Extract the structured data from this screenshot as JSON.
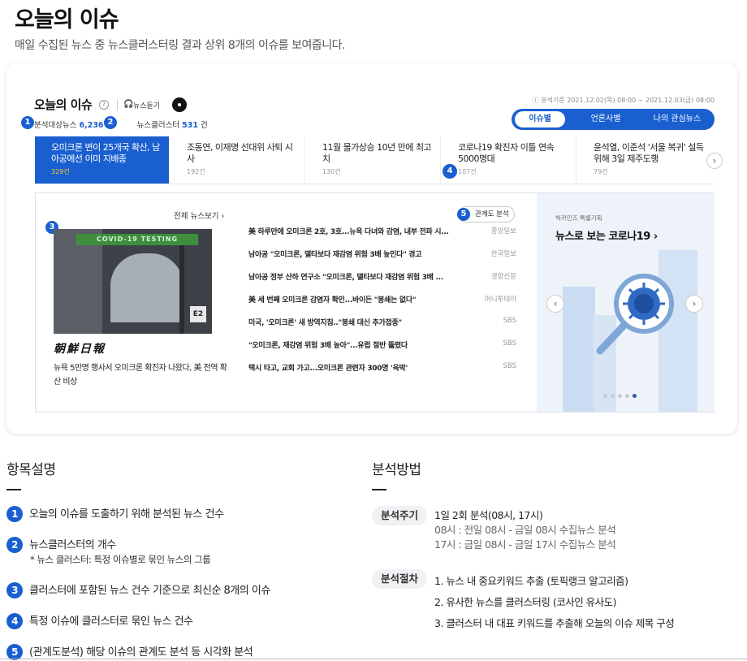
{
  "header": {
    "title": "오늘의 이슈",
    "subtitle": "매일 수집된 뉴스 중 뉴스클러스터링 결과 상위 8개의 이슈를 보여줍니다."
  },
  "widget": {
    "title": "오늘의 이슈",
    "help": "?",
    "listen_label": "뉴스듣기",
    "period": "ⓘ 분석기준 2021.12.02(목) 08:00 ~ 2021.12.03(금) 08:00",
    "stats": {
      "analyzed_label": "분석대상뉴스",
      "analyzed_value": "6,236 건",
      "cluster_label": "뉴스클러스터",
      "cluster_value": "531",
      "cluster_unit": "건"
    },
    "tabs": [
      "이슈별",
      "언론사별",
      "나의 관심뉴스"
    ],
    "issues": [
      {
        "title": "오미크론 변이 25개국 확산, 남아공에선 이미 지배종",
        "count": "329건"
      },
      {
        "title": "조동연, 이재명 선대위 사퇴 시사",
        "count": "192건"
      },
      {
        "title": "11월 물가상승 10년 만에 최고치",
        "count": "130건"
      },
      {
        "title": "코로나19 확진자 이틀 연속 5000명대",
        "count": "107건"
      },
      {
        "title": "윤석열, 이준석 '서울 복귀' 설득 위해 3일 제주도행",
        "count": "79건"
      }
    ],
    "next_arrow": "›",
    "all_news": "전체 뉴스보기 ›",
    "cluster_button": "관계도 분석",
    "photo_banner": "COVID-19 TESTING",
    "photo_sign": "E2",
    "paper_logo": "朝鮮日報",
    "photo_caption": "뉴욕 5만명 행사서 오미크론 확진자 나왔다, 美 전역 확산 비상",
    "news": [
      {
        "title": "美 하루만에 오미크론 2호, 3호...뉴욕 다녀와 감염, 내부 전파 시...",
        "source": "중앙일보"
      },
      {
        "title": "남아공 \"오미크론, 델타보다 재감염 위험 3배 높인다\" 경고",
        "source": "한국일보"
      },
      {
        "title": "남아공 정부 산하 연구소 \"오미크론, 델타보다 재감염 위험 3배 ...",
        "source": "경향신문"
      },
      {
        "title": "美 세 번째 오미크론 감염자 확인...바이든 \"봉쇄는 없다\"",
        "source": "머니투데이"
      },
      {
        "title": "미국, '오미크론' 새 방역지침..\"봉쇄 대신 추가접종\"",
        "source": "SBS"
      },
      {
        "title": "\"오미크론, 재감염 위험 3배 높아\"...유럽 절반 뚫렸다",
        "source": "SBS"
      },
      {
        "title": "택시 타고, 교회 가고...오미크론 관련자 300명 '육박'",
        "source": "SBS"
      }
    ],
    "promo": {
      "small": "빅카인즈 특별기획",
      "title": "뉴스로 보는 코로나19 ›",
      "prev": "‹",
      "next": "›"
    }
  },
  "badges": [
    "1",
    "2",
    "3",
    "4",
    "5"
  ],
  "items_section": {
    "title": "항목설명",
    "items": [
      "오늘의 이슈를 도출하기 위해 분석된 뉴스 건수",
      "뉴스클러스터의 개수",
      "클러스터에 포함된 뉴스 건수 기준으로 최신순 8개의 이슈",
      "특정 이슈에 클러스터로 묶인 뉴스 건수",
      "(관계도분석) 해당 이슈의 관계도 분석 등 시각화 분석"
    ],
    "note": "* 뉴스 클러스터: 특정 이슈별로 묶인 뉴스의 그룹"
  },
  "method_section": {
    "title": "분석방법",
    "cycle_label": "분석주기",
    "cycle_lines": [
      "1일 2회 분석(08시, 17시)",
      "08시 : 전일 08시 - 금일 08시 수집뉴스 분석",
      "17시 : 금일 08시 - 금일 17시 수집뉴스 분석"
    ],
    "process_label": "분석절차",
    "process_lines": [
      "1. 뉴스 내 중요키워드 추출 (토픽랭크 알고리즘)",
      "2. 유사한 뉴스를 클러스터링 (코사인 유사도)",
      "3. 클러스터 내 대표 키워드를 추출해 오늘의 이슈 제목 구성"
    ]
  },
  "colors": {
    "accent": "#1a5fd0",
    "count_highlight": "#ffcc33",
    "promo_bg": "#eef3fa"
  }
}
